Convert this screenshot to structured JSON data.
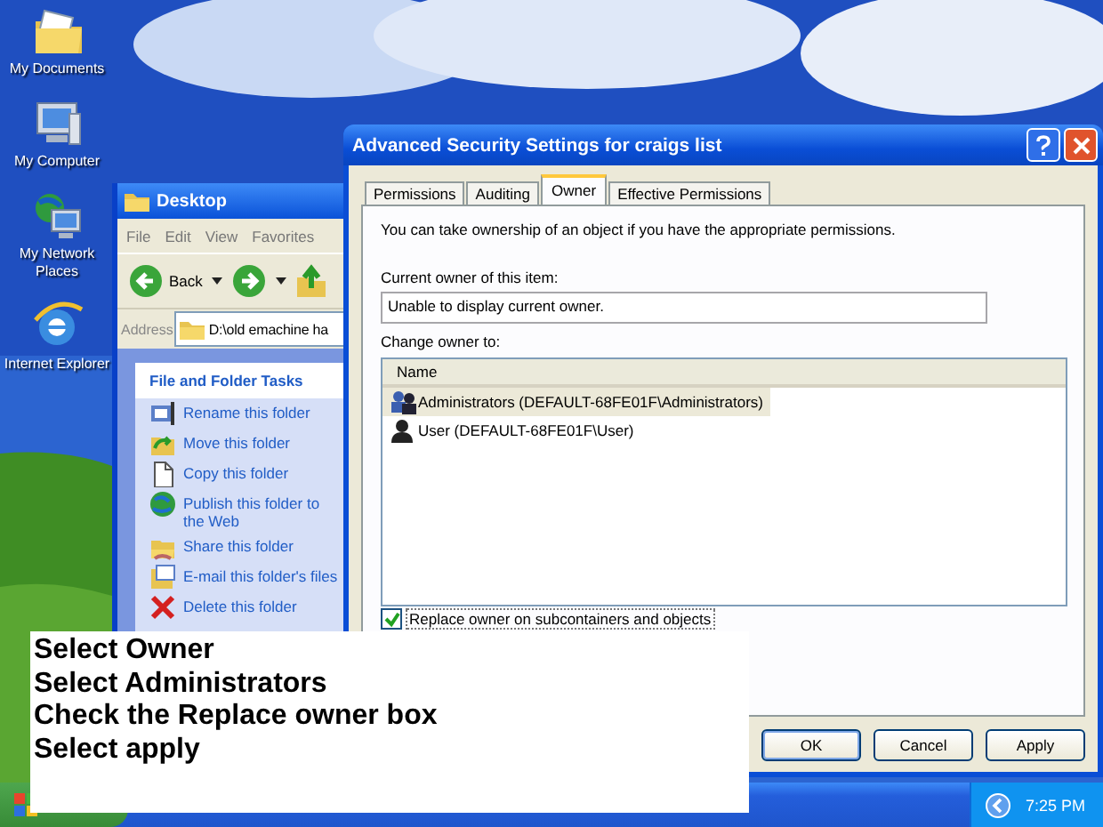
{
  "desktop_icons": [
    {
      "label": "My Documents",
      "kind": "documents"
    },
    {
      "label": "My Computer",
      "kind": "computer"
    },
    {
      "label": "My Network Places",
      "kind": "network"
    },
    {
      "label": "Internet Explorer",
      "kind": "browser"
    }
  ],
  "explorer": {
    "title": "Desktop",
    "menu": [
      "File",
      "Edit",
      "View",
      "Favorites"
    ],
    "back_label": "Back",
    "address_label": "Address",
    "address": "D:\\old emachine ha",
    "tasks_title": "File and Folder Tasks",
    "tasks": [
      {
        "label": "Rename this folder",
        "kind": "rename"
      },
      {
        "label": "Move this folder",
        "kind": "move"
      },
      {
        "label": "Copy this folder",
        "kind": "copy"
      },
      {
        "label": "Publish this folder to the Web",
        "kind": "publish"
      },
      {
        "label": "Share this folder",
        "kind": "share"
      },
      {
        "label": "E-mail this folder's files",
        "kind": "email"
      },
      {
        "label": "Delete this folder",
        "kind": "delete"
      }
    ]
  },
  "dialog": {
    "title": "Advanced Security Settings for craigs list",
    "tabs": [
      {
        "label": "Permissions",
        "selected": false
      },
      {
        "label": "Auditing",
        "selected": false
      },
      {
        "label": "Owner",
        "selected": true
      },
      {
        "label": "Effective Permissions",
        "selected": false
      }
    ],
    "intro": "You can take ownership of an object if you have the appropriate permissions.",
    "current_owner_label": "Current owner of this item:",
    "current_owner": "Unable to display current owner.",
    "change_owner_label": "Change owner to:",
    "column": "Name",
    "owners": [
      {
        "label": "Administrators (DEFAULT-68FE01F\\Administrators)",
        "kind": "group",
        "selected": true
      },
      {
        "label": "User (DEFAULT-68FE01F\\User)",
        "kind": "user",
        "selected": false
      }
    ],
    "replace": {
      "label": "Replace owner on subcontainers and objects",
      "checked": true
    },
    "buttons": [
      "OK",
      "Cancel",
      "Apply"
    ]
  },
  "instructions": [
    "Select Owner",
    "Select Administrators",
    "Check the Replace owner box",
    "Select apply"
  ],
  "taskbar": {
    "clock": "7:25 PM"
  }
}
